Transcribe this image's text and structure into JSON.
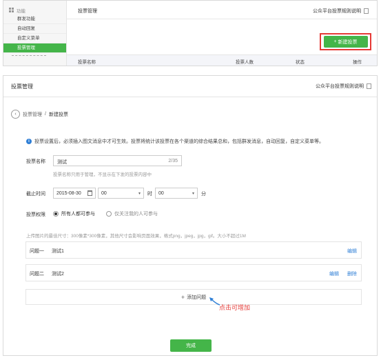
{
  "top": {
    "sidebar": {
      "section_label": "功能",
      "items": [
        {
          "label": "群发功能"
        },
        {
          "label": "自动回复"
        },
        {
          "label": "自定义菜单"
        },
        {
          "label": "投票管理"
        }
      ]
    },
    "page_title": "投票管理",
    "rules_link": "公众平台投票规则说明",
    "new_vote_button": "新建投票",
    "table_headers": [
      "投票名称",
      "投票人数",
      "状态",
      "操作"
    ]
  },
  "panel": {
    "title": "投票管理",
    "rules_link": "公众平台投票规则说明",
    "breadcrumb": {
      "parent": "投票管理",
      "separator": "/",
      "current": "新建投票"
    },
    "notice": "投票设置后，必须插入图文消息中才可生效。投票将统计该投票在各个渠道的综合结果总和，包括群发消息，自动回复，自定义菜单等。",
    "name_label": "投票名称",
    "name_value": "测试",
    "name_count": "2/35",
    "name_hint": "投票名称只用于管理，不显示在下发的投票内容中",
    "deadline_label": "截止时间",
    "deadline_date": "2015-08-30",
    "hour_value": "00",
    "hour_unit": "时",
    "minute_value": "00",
    "minute_unit": "分",
    "permission_label": "投票权限",
    "permission_options": [
      {
        "label": "所有人都可参与",
        "selected": true
      },
      {
        "label": "仅关注我的人可参与",
        "selected": false
      }
    ],
    "upload_note": "上传图片的最佳尺寸：300像素*300像素，其他尺寸会影响页面效果，格式png，jpeg，jpg，gif。大小不超过1M",
    "questions": [
      {
        "number": "问题一",
        "title": "测试1",
        "actions": [
          "编辑"
        ]
      },
      {
        "number": "问题二",
        "title": "测试2",
        "actions": [
          "编辑",
          "删除"
        ]
      }
    ],
    "add_question": "添加问题",
    "annotation": "点击可增加",
    "done_button": "完成"
  },
  "colors": {
    "primary_green": "#44b549",
    "highlight_red": "#e53935",
    "link_blue": "#2f7fd6"
  }
}
